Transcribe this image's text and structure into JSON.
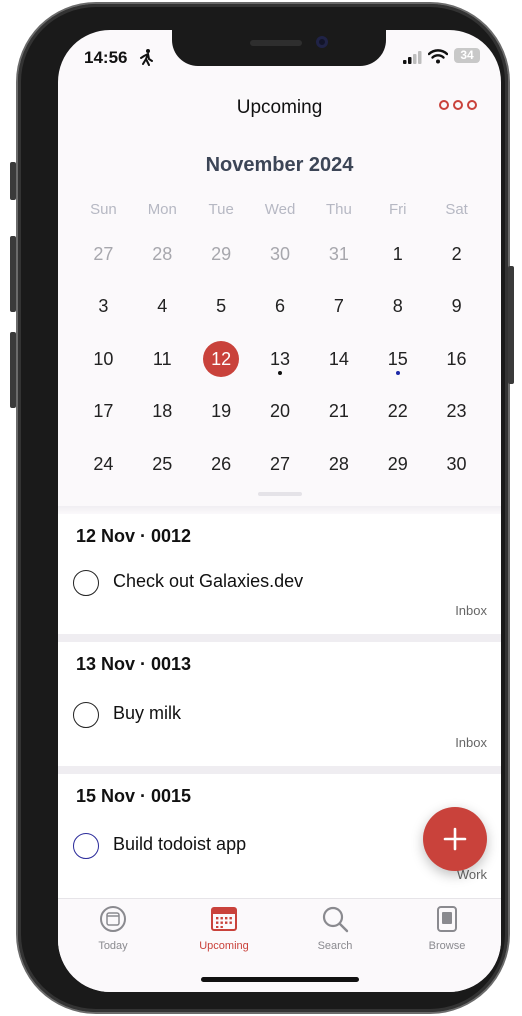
{
  "status_bar": {
    "time": "14:56",
    "battery": "34"
  },
  "header": {
    "title": "Upcoming"
  },
  "calendar": {
    "month_label": "November 2024",
    "weekdays": [
      "Sun",
      "Mon",
      "Tue",
      "Wed",
      "Thu",
      "Fri",
      "Sat"
    ],
    "weeks": [
      [
        "27",
        "28",
        "29",
        "30",
        "31",
        "1",
        "2"
      ],
      [
        "3",
        "4",
        "5",
        "6",
        "7",
        "8",
        "9"
      ],
      [
        "10",
        "11",
        "12",
        "13",
        "14",
        "15",
        "16"
      ],
      [
        "17",
        "18",
        "19",
        "20",
        "21",
        "22",
        "23"
      ],
      [
        "24",
        "25",
        "26",
        "27",
        "28",
        "29",
        "30"
      ]
    ],
    "selected_day": "12",
    "marked_days": [
      {
        "day": "13",
        "color": "#111111"
      },
      {
        "day": "15",
        "color": "#1e2aa8"
      }
    ]
  },
  "sections": [
    {
      "title": "12 Nov · 0012",
      "tasks": [
        {
          "name": "Check out Galaxies.dev",
          "project": "Inbox",
          "circle_color": "#222222"
        }
      ]
    },
    {
      "title": "13 Nov · 0013",
      "tasks": [
        {
          "name": "Buy milk",
          "project": "Inbox",
          "circle_color": "#222222"
        }
      ]
    },
    {
      "title": "15 Nov · 0015",
      "tasks": [
        {
          "name": "Build todoist app",
          "project": "Work",
          "circle_color": "#2a2a9a"
        }
      ]
    }
  ],
  "tabs": [
    {
      "label": "Today",
      "icon": "today-icon",
      "active": false
    },
    {
      "label": "Upcoming",
      "icon": "calendar-grid-icon",
      "active": true
    },
    {
      "label": "Search",
      "icon": "search-icon",
      "active": false
    },
    {
      "label": "Browse",
      "icon": "browse-icon",
      "active": false
    }
  ],
  "colors": {
    "accent": "#c9423b"
  }
}
